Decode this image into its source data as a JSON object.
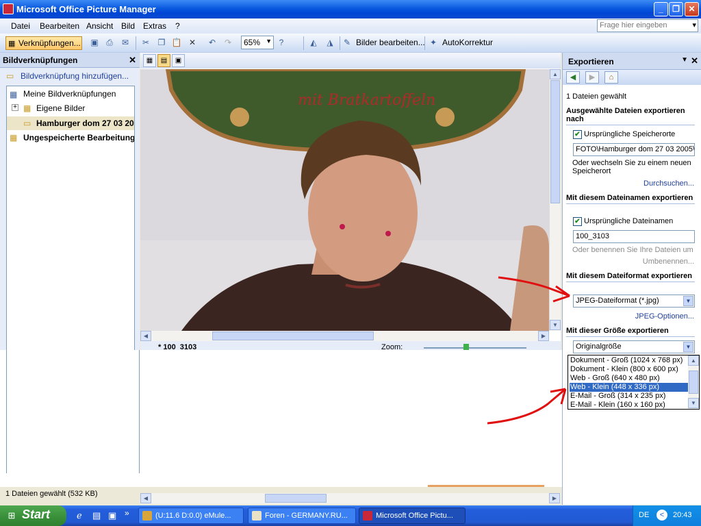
{
  "window": {
    "title": "Microsoft Office Picture Manager"
  },
  "menu": {
    "items": [
      "Datei",
      "Bearbeiten",
      "Ansicht",
      "Bild",
      "Extras",
      "?"
    ],
    "ask_placeholder": "Frage hier eingeben"
  },
  "toolbar": {
    "shortcuts_label": "Verknüpfungen...",
    "zoom_value": "65%",
    "edit_pictures_label": "Bilder bearbeiten...",
    "autocorrect_label": "AutoKorrektur"
  },
  "left_pane": {
    "title": "Bildverknüpfungen",
    "add_link": "Bildverknüpfung hinzufügen...",
    "tree": {
      "root": "Meine Bildverknüpfungen",
      "child1": "Eigene Bilder",
      "child2": "Hamburger dom 27 03 20",
      "unsaved": "Ungespeicherte Bearbeitung"
    }
  },
  "status": {
    "text": "1 Dateien gewählt (532 KB)"
  },
  "center": {
    "filename_partial": "* 100_3103",
    "zoom_label": "Zoom:"
  },
  "right_pane": {
    "title": "Exportieren",
    "selected_count": "1 Dateien gewählt",
    "sec_location": "Ausgewählte Dateien exportieren nach",
    "chk_location_label": "Ursprüngliche Speicherorte",
    "location_value": "FOTO\\Hamburger dom 27 03 2005\\",
    "location_hint": "Oder wechseln Sie zu einem neuen Speicherort",
    "browse_link": "Durchsuchen...",
    "sec_filename": "Mit diesem Dateinamen exportieren",
    "chk_filename_label": "Ursprüngliche Dateinamen",
    "filename_value": "100_3103",
    "rename_hint": "Oder benennen Sie Ihre Dateien um",
    "rename_link": "Umbenennen...",
    "sec_format": "Mit diesem Dateiformat exportieren",
    "format_value": "JPEG-Dateiformat (*.jpg)",
    "jpeg_options_link": "JPEG-Optionen...",
    "sec_size": "Mit dieser Größe exportieren",
    "size_value": "Originalgröße",
    "size_options": [
      "Dokument - Groß (1024 x 768 px)",
      "Dokument - Klein (800 x 600 px)",
      "Web - Groß (640 x 480 px)",
      "Web - Klein (448 x 336 px)",
      "E-Mail - Groß (314 x 235 px)",
      "E-Mail - Klein (160 x 160 px)"
    ],
    "size_selected": "Web - Klein (448 x 336 px)"
  },
  "taskbar": {
    "start": "Start",
    "tasks": [
      "(U:11.6 D:0.0) eMule...",
      "Foren - GERMANY.RU...",
      "Microsoft Office Pictu..."
    ],
    "lang": "DE",
    "clock": "20:43"
  },
  "colors": {
    "accent": "#0a5adf",
    "selection": "#316ac5",
    "annotation_arrow": "#e01010"
  },
  "photo": {
    "sign_text": "mit Bratkartoffeln"
  }
}
